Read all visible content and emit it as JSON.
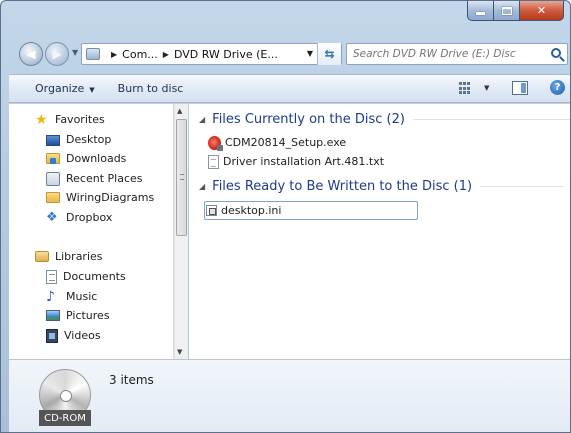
{
  "address": {
    "crumbs": [
      "Com...",
      "DVD RW Drive (E..."
    ]
  },
  "search": {
    "placeholder": "Search DVD RW Drive (E:) Disc"
  },
  "toolbar": {
    "organize_label": "Organize",
    "burn_label": "Burn to disc"
  },
  "nav": {
    "favorites": {
      "header": "Favorites",
      "items": [
        {
          "label": "Desktop",
          "icon": "desktop-icon"
        },
        {
          "label": "Downloads",
          "icon": "downloads-folder-icon"
        },
        {
          "label": "Recent Places",
          "icon": "recent-places-icon"
        },
        {
          "label": "WiringDiagrams",
          "icon": "folder-icon"
        },
        {
          "label": "Dropbox",
          "icon": "dropbox-icon"
        }
      ]
    },
    "libraries": {
      "header": "Libraries",
      "items": [
        {
          "label": "Documents",
          "icon": "documents-icon"
        },
        {
          "label": "Music",
          "icon": "music-icon"
        },
        {
          "label": "Pictures",
          "icon": "pictures-icon"
        },
        {
          "label": "Videos",
          "icon": "videos-icon"
        }
      ]
    }
  },
  "content": {
    "groups": [
      {
        "title": "Files Currently on the Disc (2)",
        "files": [
          {
            "name": "CDM20814_Setup.exe",
            "icon": "exe-icon"
          },
          {
            "name": "Driver installation Art.481.txt",
            "icon": "text-file-icon"
          }
        ]
      },
      {
        "title": "Files Ready to Be Written to the Disc (1)",
        "files": [
          {
            "name": "desktop.ini",
            "icon": "ini-file-icon"
          }
        ]
      }
    ]
  },
  "details": {
    "drive_label": "CD-ROM",
    "item_count": "3 items"
  }
}
